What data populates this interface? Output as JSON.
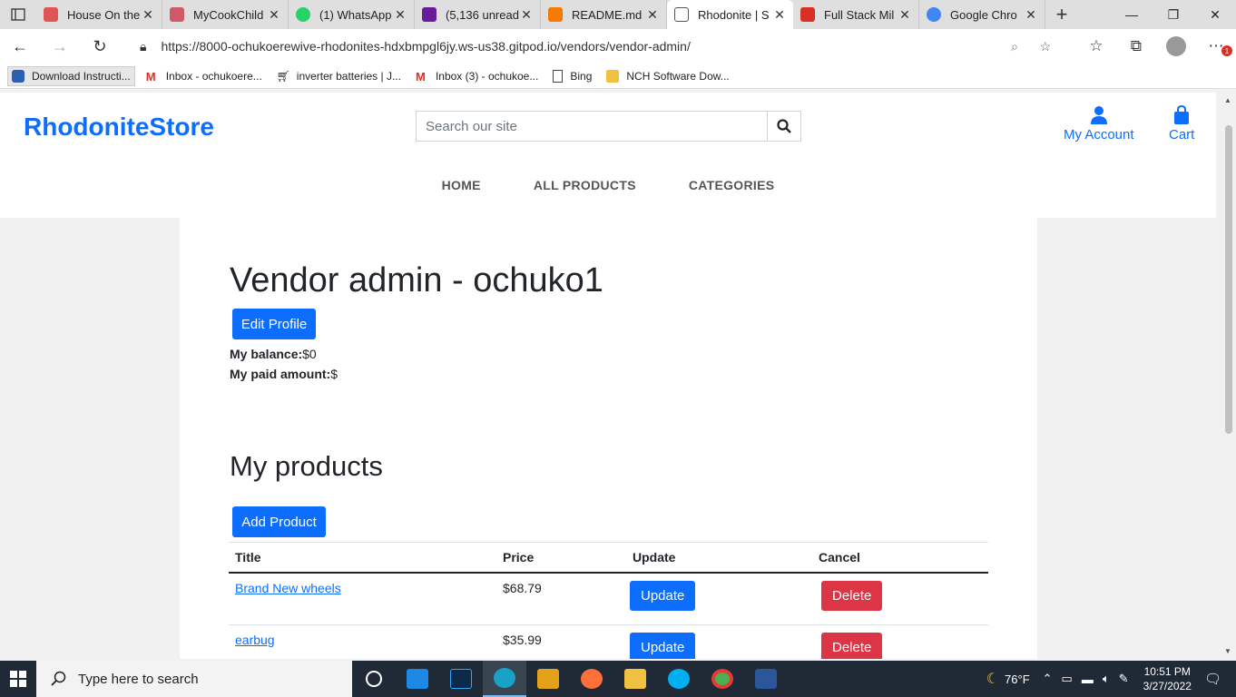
{
  "browser": {
    "tabs": [
      {
        "title": "House On the",
        "color": "#e05555"
      },
      {
        "title": "MyCookChild",
        "color": "#d05a6a"
      },
      {
        "title": "(1) WhatsApp",
        "color": "#25d366"
      },
      {
        "title": "(5,136 unread",
        "color": "#6a1b9a"
      },
      {
        "title": "README.md",
        "color": "#f57c00"
      },
      {
        "title": "Rhodonite | S",
        "color": "#555555"
      },
      {
        "title": "Full Stack Mil",
        "color": "#d93025"
      },
      {
        "title": "Google Chro",
        "color": "#4285f4"
      }
    ],
    "url": "https://8000-ochukoerewive-rhodonites-hdxbmpgl6jy.ws-us38.gitpod.io/vendors/vendor-admin/",
    "bookmarks": [
      {
        "label": "Download Instructi..."
      },
      {
        "label": "Inbox - ochukoere..."
      },
      {
        "label": "inverter batteries | J..."
      },
      {
        "label": "Inbox (3) - ochukoe..."
      },
      {
        "label": "Bing"
      },
      {
        "label": "NCH Software Dow..."
      }
    ],
    "notification_count": "1"
  },
  "site": {
    "logo": "RhodoniteStore",
    "search_placeholder": "Search our site",
    "account_label": "My Account",
    "cart_label": "Cart",
    "nav": [
      "HOME",
      "ALL PRODUCTS",
      "CATEGORIES"
    ]
  },
  "page": {
    "title": "Vendor admin - ochuko1",
    "edit_profile": "Edit Profile",
    "balance_label": "My balance:",
    "balance_value": "$0",
    "paid_label": "My paid amount:",
    "paid_value": "$",
    "products_heading": "My products",
    "add_product": "Add Product",
    "table": {
      "headers": [
        "Title",
        "Price",
        "Update",
        "Cancel"
      ],
      "rows": [
        {
          "title": "Brand New wheels",
          "price": "$68.79",
          "update": "Update",
          "cancel": "Delete"
        },
        {
          "title": "earbug",
          "price": "$35.99",
          "update": "Update",
          "cancel": "Delete"
        }
      ]
    }
  },
  "taskbar": {
    "search_placeholder": "Type here to search",
    "weather": "76°F",
    "time": "10:51 PM",
    "date": "3/27/2022"
  }
}
